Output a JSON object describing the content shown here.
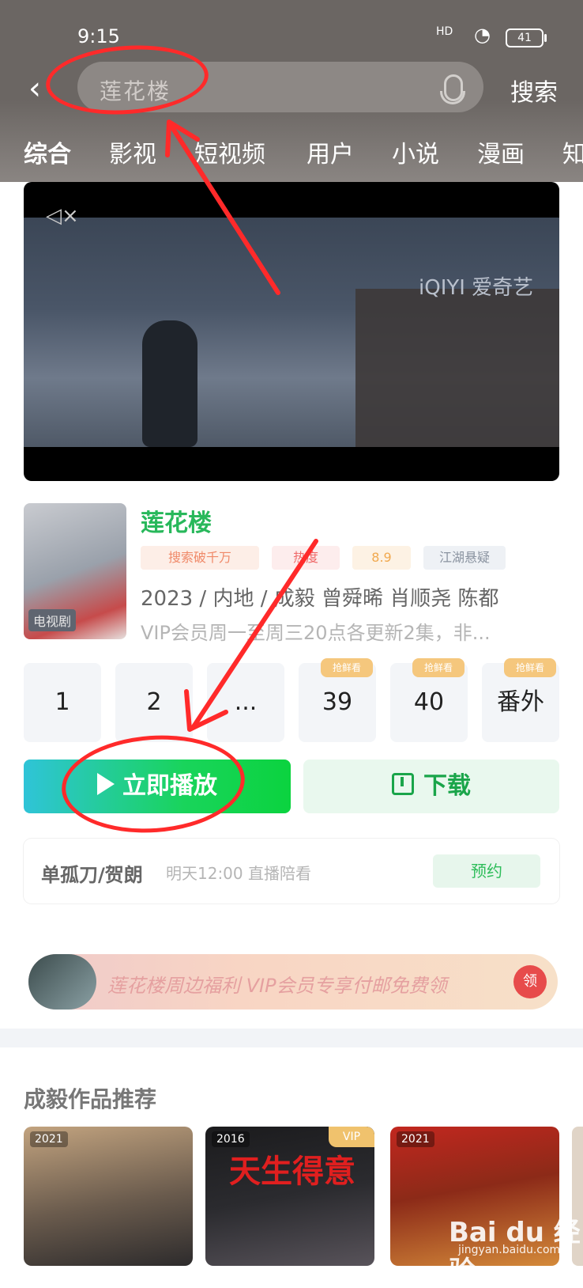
{
  "status_bar": {
    "time": "9:15",
    "signal": "HD",
    "battery": "41"
  },
  "search": {
    "query": "莲花楼",
    "button": "搜索"
  },
  "tabs": [
    {
      "label": "综合"
    },
    {
      "label": "影视"
    },
    {
      "label": "短视频"
    },
    {
      "label": "用户"
    },
    {
      "label": "小说"
    },
    {
      "label": "漫画"
    },
    {
      "label": "知"
    }
  ],
  "player": {
    "mute_icon": "speaker-muted-icon",
    "brand": "iQIYI 爱奇艺"
  },
  "show": {
    "title": "莲花楼",
    "thumb_badge": "电视剧",
    "tags": [
      "搜索破千万",
      "热度",
      "8.9",
      "江湖悬疑"
    ],
    "info": "2023 / 内地 / 成毅  曾舜晞  肖顺尧  陈都",
    "description": "VIP会员周一至周三20点各更新2集，非..."
  },
  "episodes": [
    {
      "label": "1",
      "badge": ""
    },
    {
      "label": "2",
      "badge": ""
    },
    {
      "label": "...",
      "badge": ""
    },
    {
      "label": "39",
      "badge": "抢鲜看"
    },
    {
      "label": "40",
      "badge": "抢鲜看"
    },
    {
      "label": "番外",
      "badge": "抢鲜看"
    }
  ],
  "actions": {
    "play": "立即播放",
    "download": "下载"
  },
  "live": {
    "title": "单孤刀/贺朗",
    "time": "明天12:00 直播陪看",
    "button": "预约"
  },
  "promo": {
    "text": "莲花楼周边福利 VIP会员专享付邮免费领",
    "button": "领"
  },
  "recommend": {
    "title": "成毅作品推荐",
    "posters": [
      {
        "year": "2021",
        "title": ""
      },
      {
        "year": "2016",
        "title": "天生得意",
        "vip": "VIP"
      },
      {
        "year": "2021",
        "title": ""
      }
    ]
  },
  "watermark": {
    "brand": "Bai du 经验",
    "site": "jingyan.baidu.com"
  },
  "colors": {
    "accent_green": "#1fd15c",
    "annotation_red": "#ff2a2a"
  }
}
